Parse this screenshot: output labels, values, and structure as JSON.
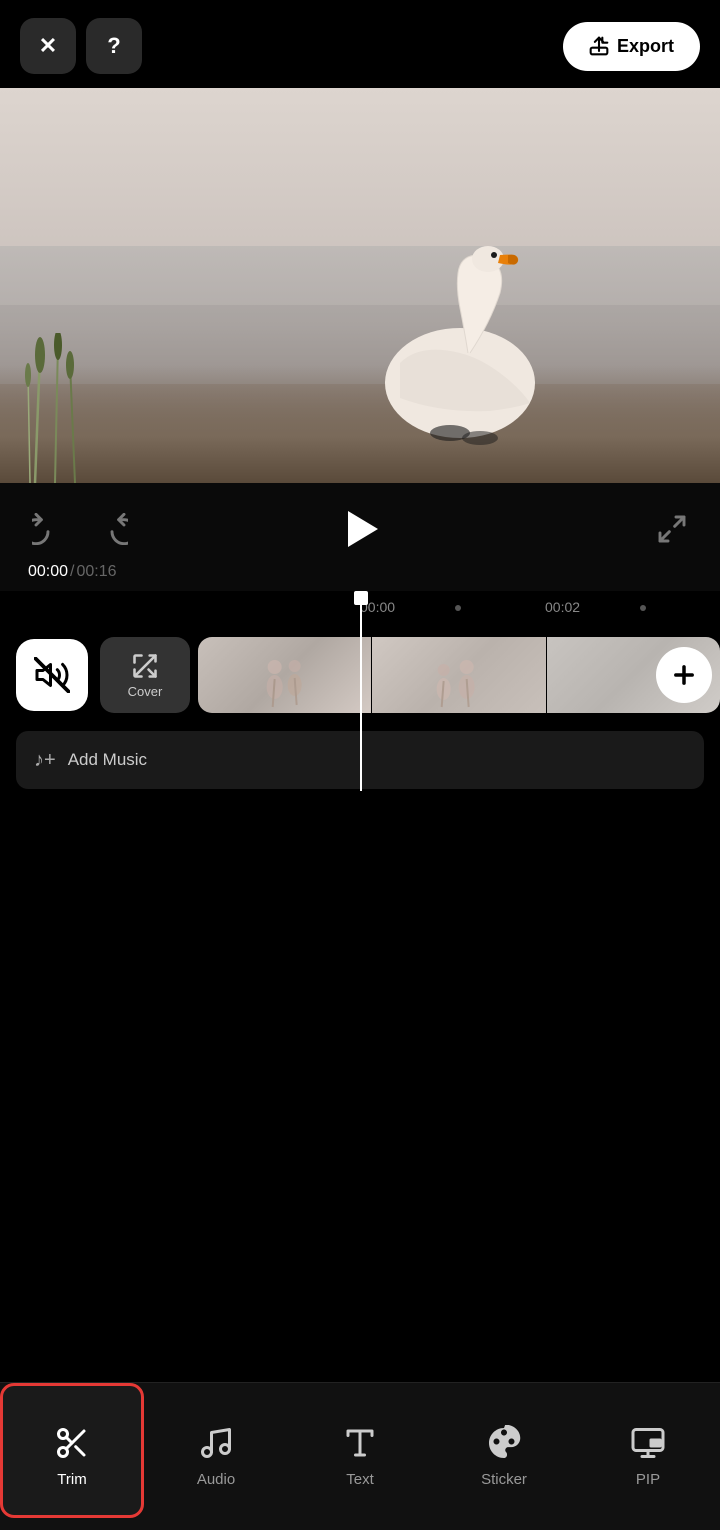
{
  "header": {
    "close_label": "✕",
    "help_label": "?",
    "export_label": "Export"
  },
  "playback": {
    "time_current": "00:00",
    "time_separator": "/",
    "time_total": "00:16"
  },
  "timeline": {
    "ruler_times": [
      "00:00",
      "00:02"
    ],
    "cover_label": "Cover",
    "add_music_label": "Add Music"
  },
  "bottom_nav": {
    "items": [
      {
        "id": "trim",
        "label": "Trim",
        "active": true
      },
      {
        "id": "audio",
        "label": "Audio",
        "active": false
      },
      {
        "id": "text",
        "label": "Text",
        "active": false
      },
      {
        "id": "sticker",
        "label": "Sticker",
        "active": false
      },
      {
        "id": "pip",
        "label": "PIP",
        "active": false
      }
    ]
  }
}
